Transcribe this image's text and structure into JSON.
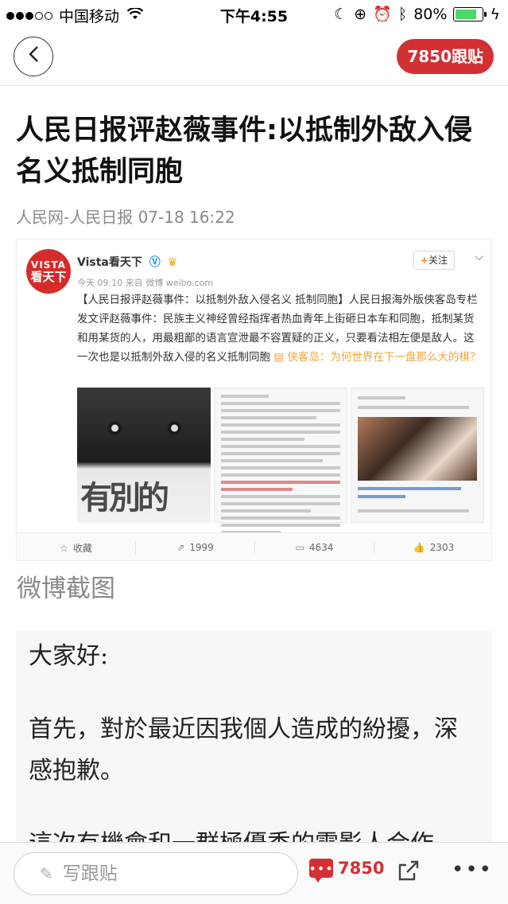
{
  "status_bar": {
    "carrier": "中国移动",
    "time": "下午4:55",
    "battery_percent": "80%",
    "battery_level": 0.8
  },
  "nav": {
    "reply_badge": "7850跟贴"
  },
  "article": {
    "title": "人民日报评赵薇事件:以抵制外敌入侵名义抵制同胞",
    "meta": "人民网-人民日报 07-18 16:22"
  },
  "weibo_card": {
    "logo_line1": "VISTA",
    "logo_line2": "看天下",
    "account_name": "Vista看天下",
    "time_source": "今天 09:10 来自 微博 weibo.com",
    "follow_label": "关注",
    "post_text": "【人民日报评赵薇事件：以抵制外敌入侵名义 抵制同胞】人民日报海外版侠客岛专栏发文评赵薇事件：民族主义神经曾经指挥者热血青年上街砸日本车和同胞，抵制某货和用某货的人，用最粗鄙的语言宣泄最不容置疑的正义，只要看法相左便是敌人。这一次也是以抵制外敌入侵的名义抵制同胞",
    "post_link": "侠客岛：为何世界在下一盘那么大的棋？",
    "poster_text": "有別的",
    "actions": {
      "favorite": "收藏",
      "repost": "1999",
      "comment": "4634",
      "like": "2303"
    }
  },
  "caption": "微博截图",
  "statement": {
    "line1": "大家好:",
    "line2": "首先，對於最近因我個人造成的紛擾，深感抱歉。",
    "line3": "這次有機會和一群極優秀的電影人合作「沒有別的愛」，我們大灣主感"
  },
  "bottom_bar": {
    "input_placeholder": "写跟贴",
    "comment_icon": "•••",
    "comment_count": "7850"
  },
  "colors": {
    "accent_red": "#d33033",
    "battery_green": "#4cd964",
    "weibo_link": "#f0a33a"
  },
  "icons": [
    "back-icon",
    "wifi-icon",
    "moon-icon",
    "rotation-lock-icon",
    "alarm-icon",
    "bluetooth-icon",
    "battery-icon",
    "charging-icon",
    "verified-icon",
    "vip-icon",
    "chevron-down-icon",
    "star-icon",
    "repost-icon",
    "comment-icon",
    "like-icon",
    "pen-icon",
    "share-icon",
    "more-icon"
  ]
}
